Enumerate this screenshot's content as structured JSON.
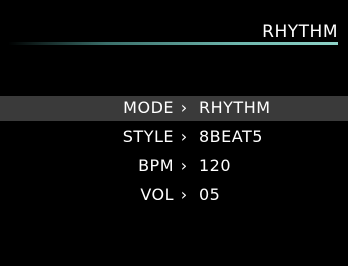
{
  "header": {
    "title": "RHYTHM"
  },
  "menu": {
    "items": [
      {
        "label": "MODE",
        "separator": "›",
        "value": "RHYTHM",
        "selected": true
      },
      {
        "label": "STYLE",
        "separator": "›",
        "value": "8BEAT5",
        "selected": false
      },
      {
        "label": "BPM",
        "separator": "›",
        "value": "120",
        "selected": false
      },
      {
        "label": "VOL",
        "separator": "›",
        "value": "05",
        "selected": false
      }
    ]
  },
  "colors": {
    "background": "#000000",
    "text": "#ffffff",
    "selected_row": "#3a3a3a",
    "accent_line": "#6fb7ae"
  }
}
